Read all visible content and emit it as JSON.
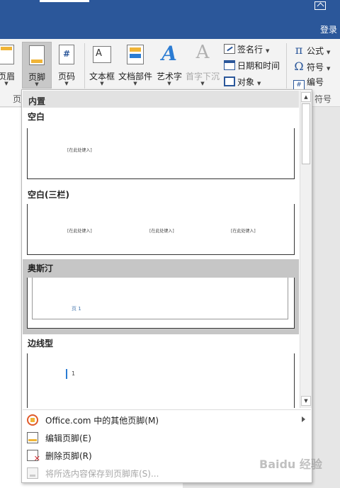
{
  "titlebar": {
    "login": "登录"
  },
  "ribbon": {
    "buttons": {
      "header": "页眉",
      "footer": "页脚",
      "page_number": "页码",
      "text_box": "文本框",
      "quick_parts": "文档部件",
      "word_art": "艺术字",
      "drop_cap": "首字下沉"
    },
    "small": {
      "signature_line": "签名行",
      "date_time": "日期和时间",
      "object": "对象",
      "equation": "公式",
      "symbol": "符号",
      "numbering": "编号"
    },
    "group_labels": {
      "header_footer_partial": "页",
      "symbols_partial": "符号"
    },
    "glyphs": {
      "page_number_icon": "#",
      "pi": "π",
      "omega": "Ω",
      "numbering_icon": "#",
      "word_art": "A",
      "drop_cap": "A"
    }
  },
  "dropdown": {
    "section_header": "内置",
    "gallery": [
      {
        "title": "空白",
        "placeholders": [
          "[在此处键入]"
        ]
      },
      {
        "title": "空白(三栏)",
        "placeholders": [
          "[在此处键入]",
          "[在此处键入]",
          "[在此处键入]"
        ]
      },
      {
        "title": "奥斯汀",
        "page_text": "页 1",
        "selected": true
      },
      {
        "title": "边线型",
        "page_text": "1"
      }
    ],
    "commands": [
      {
        "label": "Office.com 中的其他页脚(M)",
        "icon": "office-icon",
        "submenu": true,
        "enabled": true
      },
      {
        "label": "编辑页脚(E)",
        "icon": "edit-footer-icon",
        "enabled": true
      },
      {
        "label": "删除页脚(R)",
        "icon": "delete-footer-icon",
        "enabled": true
      },
      {
        "label": "将所选内容保存到页脚库(S)...",
        "icon": "save-to-gallery-icon",
        "enabled": false
      }
    ]
  },
  "watermark": "Baidu 经验",
  "colors": {
    "title_bar": "#2b579a",
    "selected_item": "#c6c6c6",
    "accent_yellow": "#f0b437",
    "accent_blue": "#2b7cd3"
  }
}
